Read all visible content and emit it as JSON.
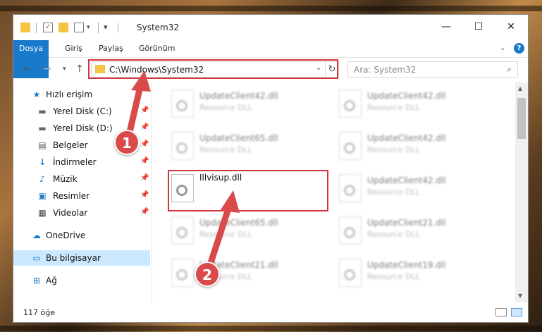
{
  "window": {
    "title": "System32",
    "controls": {
      "minimize": "—",
      "maximize": "☐",
      "close": "✕"
    }
  },
  "ribbon": {
    "tabs": [
      "Dosya",
      "Giriş",
      "Paylaş",
      "Görünüm"
    ],
    "collapse_icon": "chevron-down-icon",
    "help_icon": "help-icon"
  },
  "nav": {
    "address": "C:\\Windows\\System32",
    "search_placeholder": "Ara: System32"
  },
  "sidebar": {
    "items": [
      {
        "label": "Hızlı erişim",
        "icon": "star-icon"
      },
      {
        "label": "Yerel Disk (C:)",
        "icon": "drive-icon",
        "pinned": true
      },
      {
        "label": "Yerel Disk (D:)",
        "icon": "drive-icon",
        "pinned": true
      },
      {
        "label": "Belgeler",
        "icon": "documents-icon",
        "pinned": true
      },
      {
        "label": "İndirmeler",
        "icon": "downloads-icon",
        "pinned": true
      },
      {
        "label": "Müzik",
        "icon": "music-icon",
        "pinned": true
      },
      {
        "label": "Resimler",
        "icon": "pictures-icon",
        "pinned": true
      },
      {
        "label": "Videolar",
        "icon": "videos-icon",
        "pinned": true
      },
      {
        "label": "OneDrive",
        "icon": "onedrive-icon"
      },
      {
        "label": "Bu bilgisayar",
        "icon": "computer-icon",
        "selected": true
      },
      {
        "label": "Ağ",
        "icon": "network-icon"
      }
    ]
  },
  "files": [
    {
      "name": "UpdateClient42.dll",
      "desc": "Resource DLL",
      "blurred": true
    },
    {
      "name": "UpdateClient42.dll",
      "desc": "Resource DLL",
      "blurred": true
    },
    {
      "name": "UpdateClient65.dll",
      "desc": "Resource DLL",
      "blurred": true
    },
    {
      "name": "UpdateClient42.dll",
      "desc": "Resource DLL",
      "blurred": true
    },
    {
      "name": "Illvisup.dll",
      "desc": "",
      "blurred": false
    },
    {
      "name": "UpdateClient42.dll",
      "desc": "Resource DLL",
      "blurred": true
    },
    {
      "name": "UpdateClient65.dll",
      "desc": "Resource DLL",
      "blurred": true
    },
    {
      "name": "UpdateClient21.dll",
      "desc": "Resource DLL",
      "blurred": true
    },
    {
      "name": "UpdateClient21.dll",
      "desc": "Resource DLL",
      "blurred": true
    },
    {
      "name": "UpdateClient19.dll",
      "desc": "Resource DLL",
      "blurred": true
    }
  ],
  "status": {
    "count": "117 öğe"
  },
  "annotations": {
    "marker1": "1",
    "marker2": "2",
    "color": "#d6333e"
  }
}
